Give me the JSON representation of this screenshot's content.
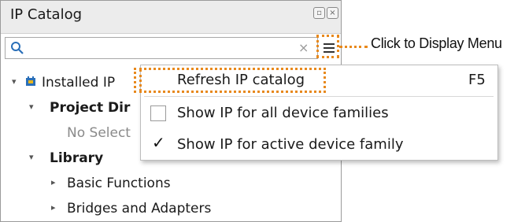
{
  "panel": {
    "title": "IP Catalog",
    "restore_icon": "restore-icon",
    "close_icon": "close-icon"
  },
  "search": {
    "placeholder": "",
    "value": "",
    "search_icon": "search-icon",
    "clear_label": "×",
    "menu_icon": "menu-icon"
  },
  "tree": {
    "installed_ip": "Installed IP",
    "project_dir": "Project Dir",
    "no_select": "No Select",
    "library": "Library",
    "basic_functions": "Basic Functions",
    "bridges_adapters": "Bridges and Adapters"
  },
  "menu": {
    "refresh_label": "Refresh IP catalog",
    "refresh_shortcut": "F5",
    "show_all_label": "Show IP for all device families",
    "show_all_checked": false,
    "show_active_label": "Show IP for active device family",
    "show_active_checked": true,
    "check_glyph": "✓"
  },
  "callout": {
    "text": "Click to Display Menu"
  },
  "colors": {
    "highlight": "#e8891d",
    "titlebar": "#ececec"
  }
}
